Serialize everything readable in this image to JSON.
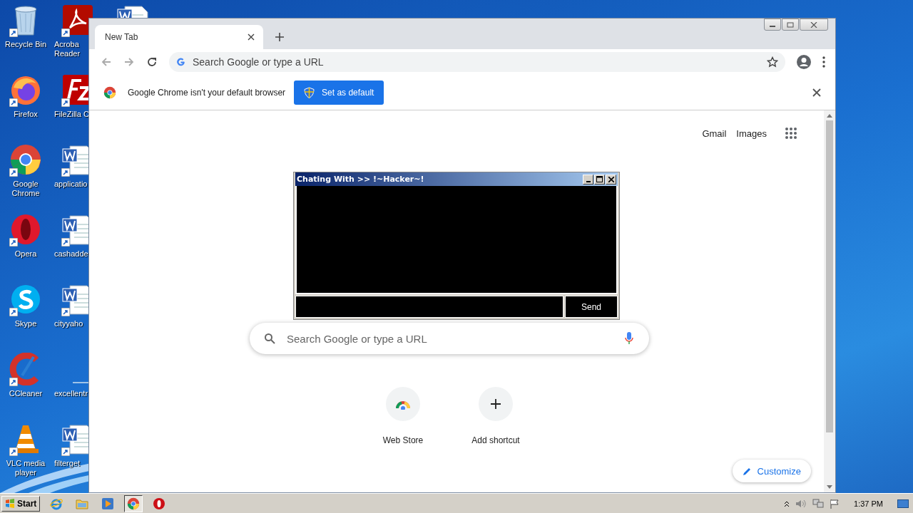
{
  "desktop": {
    "columns": [
      [
        {
          "kind": "recycle",
          "label": "Recycle Bin"
        },
        {
          "kind": "firefox",
          "label": "Firefox"
        },
        {
          "kind": "chrome",
          "label": "Google Chrome"
        },
        {
          "kind": "opera",
          "label": "Opera"
        },
        {
          "kind": "skype",
          "label": "Skype"
        },
        {
          "kind": "ccleaner",
          "label": "CCleaner"
        },
        {
          "kind": "vlc",
          "label": "VLC media player"
        }
      ],
      [
        {
          "kind": "acrobat",
          "label": "Acroba Reader"
        },
        {
          "kind": "filezilla",
          "label": "FileZilla C"
        },
        {
          "kind": "word",
          "label": "applicatio"
        },
        {
          "kind": "word",
          "label": "cashadde"
        },
        {
          "kind": "word",
          "label": "cityyaho"
        },
        {
          "kind": "blank",
          "label": "excellentr"
        },
        {
          "kind": "word",
          "label": "filterget"
        }
      ],
      [
        {
          "kind": "word"
        }
      ]
    ]
  },
  "browser": {
    "tabs": [
      {
        "label": "New Tab",
        "selected": true
      }
    ],
    "omnibox": {
      "placeholder": "Search Google or type a URL"
    },
    "infobar": {
      "message": "Google Chrome isn't your default browser",
      "button": "Set as default"
    },
    "page": {
      "links": [
        "Gmail",
        "Images"
      ],
      "search": {
        "placeholder": "Search Google or type a URL"
      },
      "shortcuts": [
        {
          "kind": "webstore",
          "label": "Web Store"
        },
        {
          "kind": "add",
          "label": "Add shortcut"
        }
      ],
      "customize": "Customize"
    }
  },
  "chat_window": {
    "title": "Chating With >> !~Hacker~!",
    "send": "Send"
  },
  "taskbar": {
    "start": "Start",
    "apps": [
      {
        "kind": "ie",
        "selected": false
      },
      {
        "kind": "folder",
        "selected": false
      },
      {
        "kind": "media",
        "selected": false
      },
      {
        "kind": "chrome",
        "selected": true
      },
      {
        "kind": "opera",
        "selected": false
      }
    ],
    "clock": "1:37 PM"
  }
}
